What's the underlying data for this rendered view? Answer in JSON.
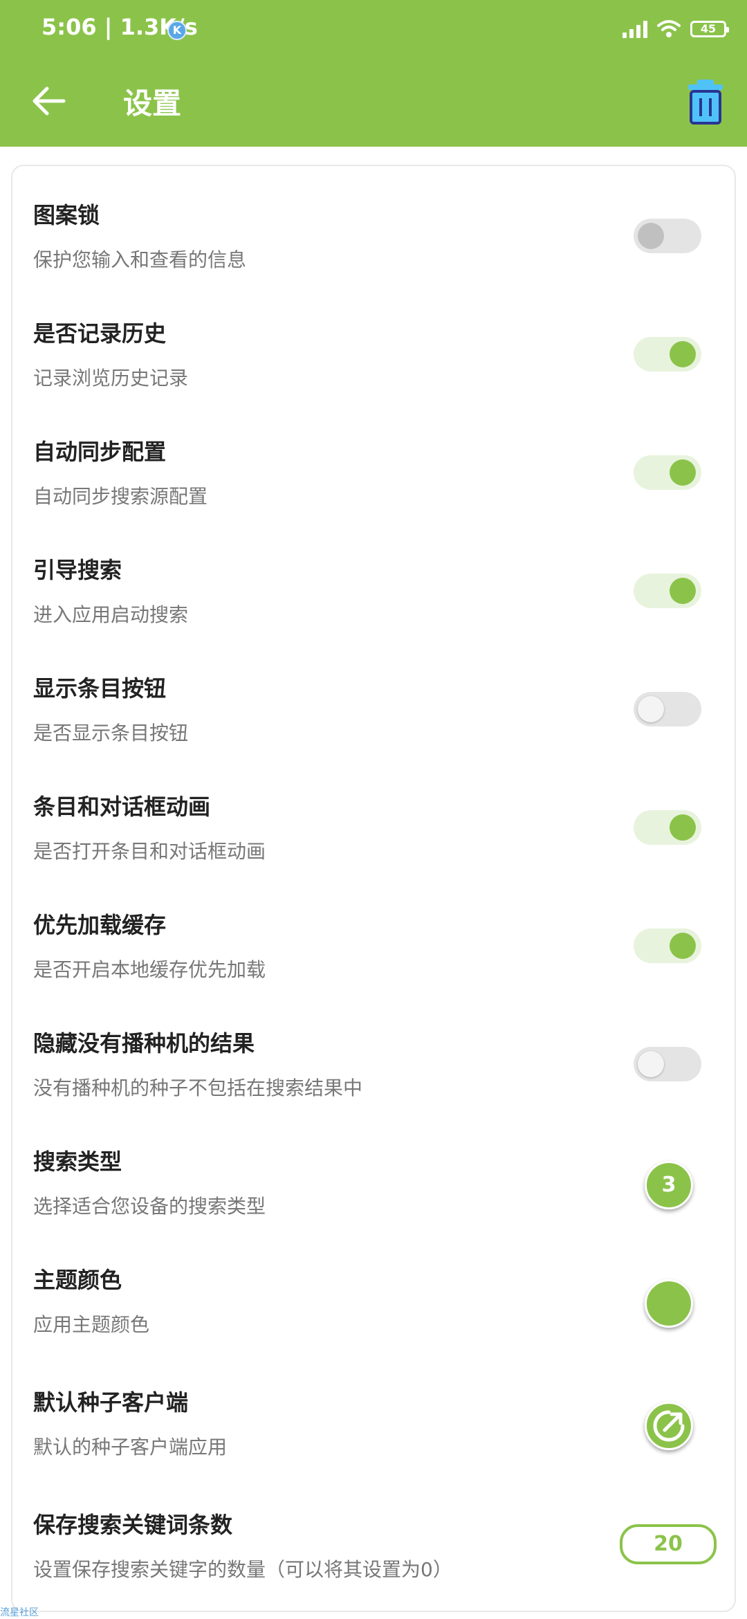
{
  "status_bar": {
    "time": "5:06 | 1.3K/s",
    "badge": "K",
    "battery": "45"
  },
  "toolbar": {
    "title": "设置",
    "back_icon": "arrow-left-icon",
    "action_icon": "trash-icon"
  },
  "colors": {
    "accent": "#8bc34a",
    "accent_light": "#e8f3dd",
    "switch_off": "#e4e4e4"
  },
  "settings": [
    {
      "title": "图案锁",
      "subtitle": "保护您输入和查看的信息",
      "control": "switch",
      "checked": false
    },
    {
      "title": "是否记录历史",
      "subtitle": "记录浏览历史记录",
      "control": "switch",
      "checked": true
    },
    {
      "title": "自动同步配置",
      "subtitle": "自动同步搜索源配置",
      "control": "switch",
      "checked": true
    },
    {
      "title": "引导搜索",
      "subtitle": "进入应用启动搜索",
      "control": "switch",
      "checked": true
    },
    {
      "title": "显示条目按钮",
      "subtitle": "是否显示条目按钮",
      "control": "switch",
      "checked": false
    },
    {
      "title": "条目和对话框动画",
      "subtitle": "是否打开条目和对话框动画",
      "control": "switch",
      "checked": true
    },
    {
      "title": "优先加载缓存",
      "subtitle": "是否开启本地缓存优先加载",
      "control": "switch",
      "checked": true
    },
    {
      "title": "隐藏没有播种机的结果",
      "subtitle": "没有播种机的种子不包括在搜索结果中",
      "control": "switch",
      "checked": false
    },
    {
      "title": "搜索类型",
      "subtitle": "选择适合您设备的搜索类型",
      "control": "value-circle",
      "value": "3"
    },
    {
      "title": "主题颜色",
      "subtitle": "应用主题颜色",
      "control": "color-circle"
    },
    {
      "title": "默认种子客户端",
      "subtitle": "默认的种子客户端应用",
      "control": "app-icon"
    },
    {
      "title": "保存搜索关键词条数",
      "subtitle": "设置保存搜索关键字的数量（可以将其设置为0）",
      "control": "value-pill",
      "value": "20"
    }
  ],
  "watermark": "流星社区"
}
